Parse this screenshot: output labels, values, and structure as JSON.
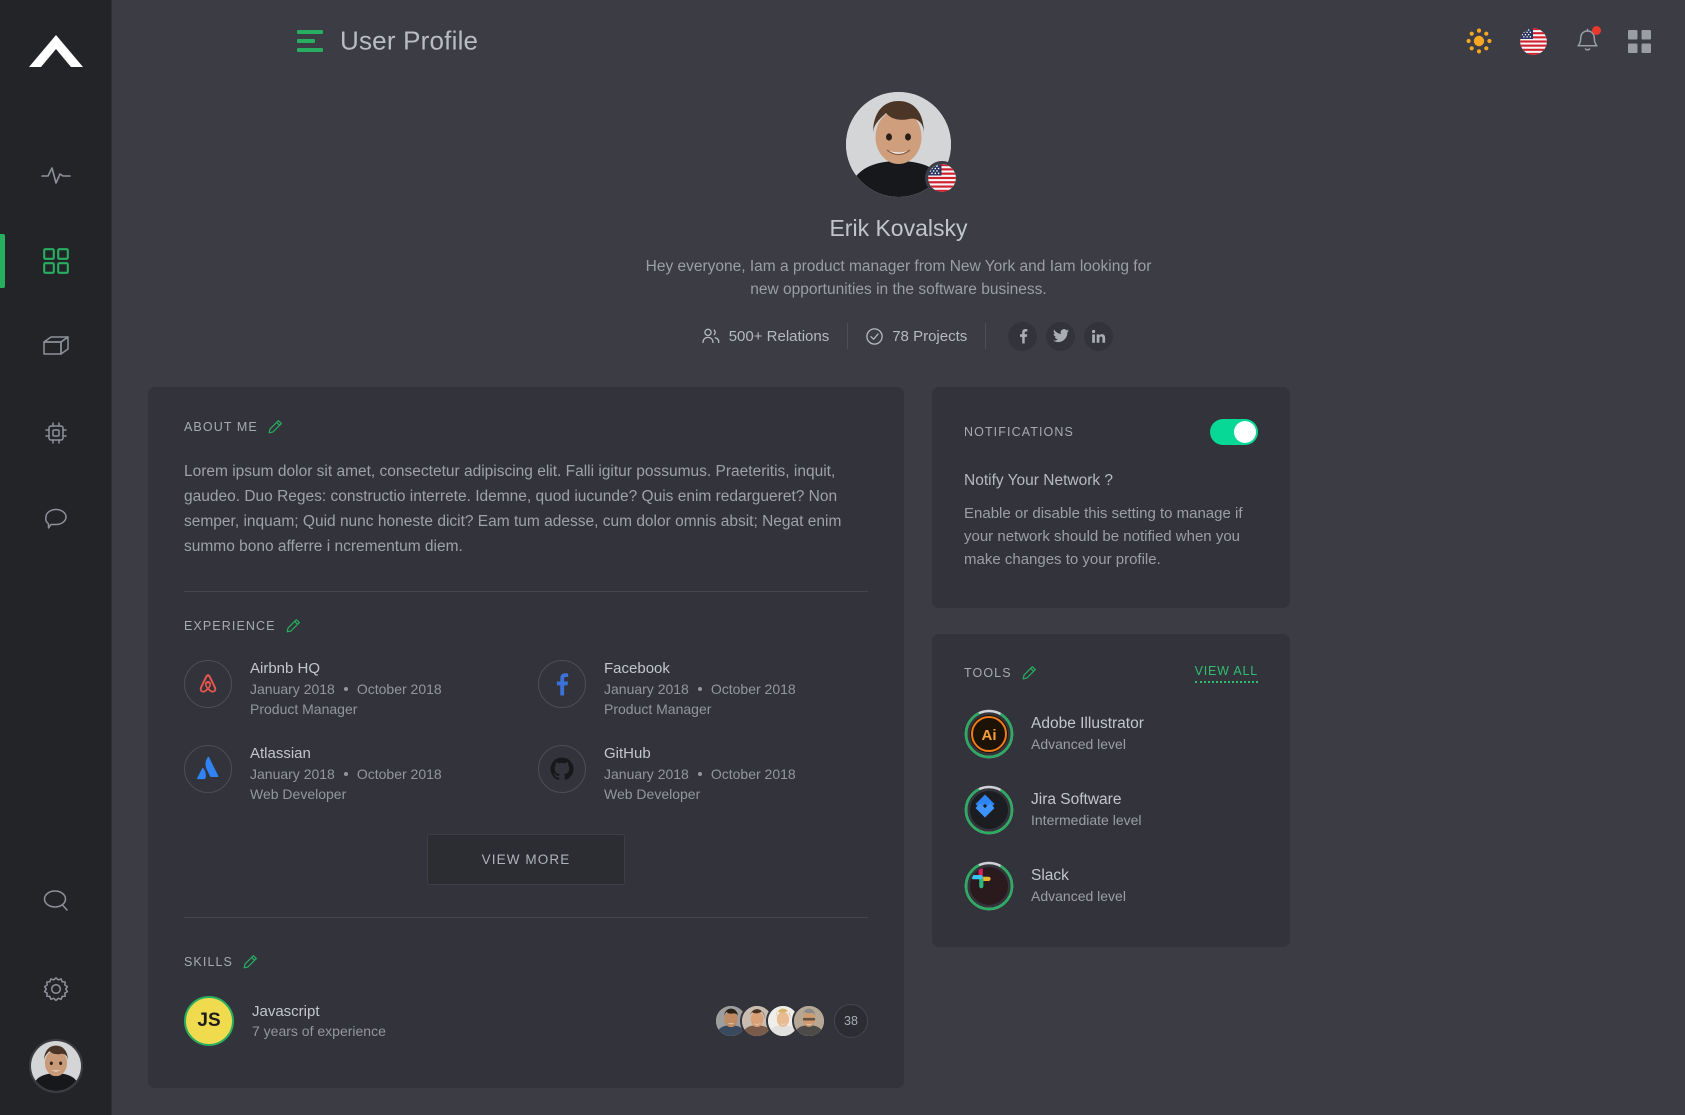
{
  "sidebar": {
    "logo_name": "triangle-logo",
    "items": [
      {
        "name": "activity",
        "icon": "pulse-icon",
        "active": false
      },
      {
        "name": "dashboard",
        "icon": "grid-icon",
        "active": true
      },
      {
        "name": "packages",
        "icon": "box-icon",
        "active": false
      },
      {
        "name": "devices",
        "icon": "chip-icon",
        "active": false
      },
      {
        "name": "messages",
        "icon": "chat-bubble-icon",
        "active": false
      }
    ],
    "bottom_items": [
      {
        "name": "search",
        "icon": "search-icon"
      },
      {
        "name": "settings",
        "icon": "gear-icon"
      }
    ],
    "avatar_name": "user-avatar"
  },
  "topbar": {
    "menu_icon": "hamburger-icon",
    "title": "User Profile",
    "actions": [
      {
        "name": "theme-toggle",
        "icon": "sun-icon"
      },
      {
        "name": "language-selector",
        "icon": "usa-flag-icon"
      },
      {
        "name": "notifications",
        "icon": "bell-icon",
        "badge": true
      },
      {
        "name": "apps-menu",
        "icon": "grid-apps-icon"
      }
    ]
  },
  "profile": {
    "name": "Erik Kovalsky",
    "bio": "Hey everyone,  Iam a product manager from New York and Iam looking for new opportunities in the software business.",
    "country_flag": "usa-flag-icon",
    "stats": [
      {
        "icon": "people-icon",
        "label": "500+ Relations"
      },
      {
        "icon": "check-circle-icon",
        "label": "78 Projects"
      }
    ],
    "socials": [
      {
        "name": "facebook",
        "glyph": "f"
      },
      {
        "name": "twitter",
        "glyph": "t"
      },
      {
        "name": "linkedin",
        "glyph": "in"
      }
    ]
  },
  "about": {
    "title": "ABOUT ME",
    "edit_icon": "pencil-icon",
    "text": "Lorem ipsum dolor sit amet, consectetur adipiscing elit. Falli igitur possumus. Praeteritis, inquit, gaudeo. Duo Reges: constructio interrete. Idemne, quod iucunde? Quis enim redargueret? Non semper, inquam; Quid nunc honeste dicit? Eam tum adesse, cum dolor omnis absit; Negat enim summo bono afferre i ncrementum diem."
  },
  "experience": {
    "title": "EXPERIENCE",
    "edit_icon": "pencil-icon",
    "items": [
      {
        "company": "Airbnb HQ",
        "logo": "airbnb-icon",
        "start": "January 2018",
        "end": "October 2018",
        "role": "Product Manager"
      },
      {
        "company": "Facebook",
        "logo": "facebook-icon",
        "start": "January 2018",
        "end": "October 2018",
        "role": "Product Manager"
      },
      {
        "company": "Atlassian",
        "logo": "atlassian-icon",
        "start": "January 2018",
        "end": "October 2018",
        "role": "Web Developer"
      },
      {
        "company": "GitHub",
        "logo": "github-icon",
        "start": "January 2018",
        "end": "October 2018",
        "role": "Web Developer"
      }
    ],
    "view_more_label": "VIEW MORE"
  },
  "skills": {
    "title": "SKILLS",
    "edit_icon": "pencil-icon",
    "items": [
      {
        "badge": "JS",
        "name": "Javascript",
        "experience": "7 years of experience",
        "people_count": "38"
      }
    ]
  },
  "notifications": {
    "title": "NOTIFICATIONS",
    "enabled": true,
    "question": "Notify Your Network ?",
    "description": "Enable or disable this setting to manage if your network should be notified when you make changes to your profile."
  },
  "tools": {
    "title": "TOOLS",
    "edit_icon": "pencil-icon",
    "view_all_label": "VIEW ALL",
    "items": [
      {
        "name": "Adobe Illustrator",
        "level": "Advanced level",
        "icon": "adobe-illustrator-icon",
        "progress": 85
      },
      {
        "name": "Jira Software",
        "level": "Intermediate level",
        "icon": "jira-icon",
        "progress": 85
      },
      {
        "name": "Slack",
        "level": "Advanced level",
        "icon": "slack-icon",
        "progress": 85
      }
    ]
  },
  "colors": {
    "accent_green": "#27ae60",
    "toggle_green": "#07d895",
    "page_bg": "#3b3c44",
    "card_bg": "#33343b",
    "sidebar_bg": "#232427",
    "badge_red": "#e8392f"
  }
}
